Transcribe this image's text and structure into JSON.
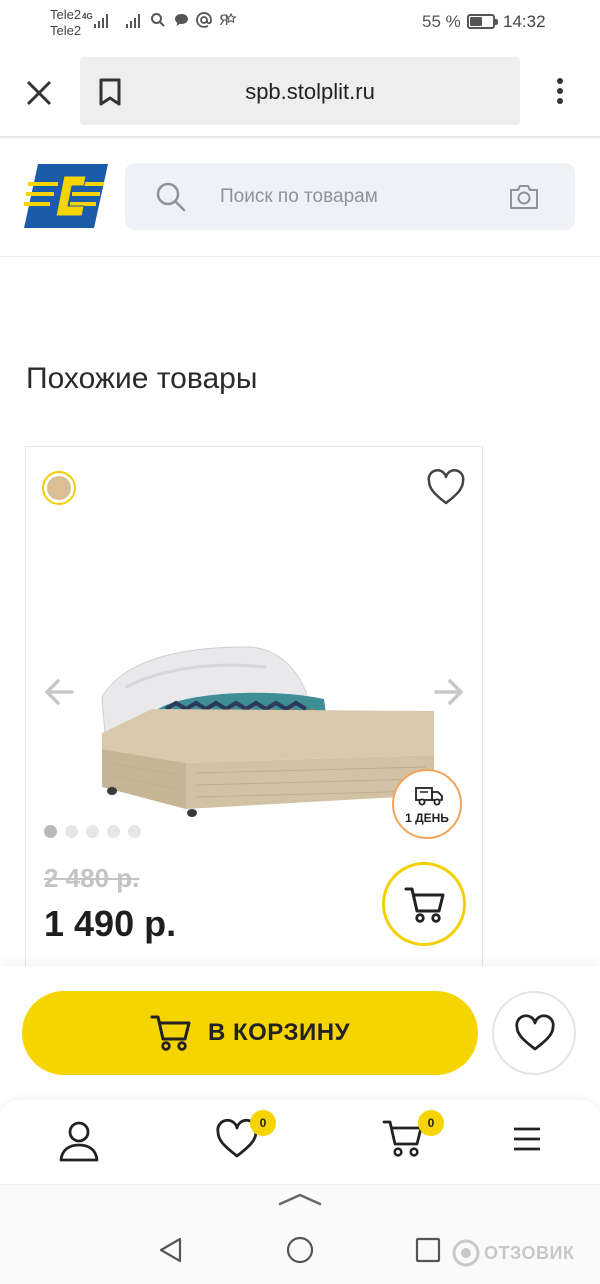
{
  "status_bar": {
    "carrier_1": "Tele2",
    "carrier_2": "Tele2",
    "network": "4G",
    "battery_percent": "55 %",
    "battery_level": 0.55,
    "time": "14:32",
    "icons": [
      "signal-icon",
      "signal-icon",
      "search-icon",
      "chat-icon",
      "at-icon",
      "yandex-icon"
    ]
  },
  "browser": {
    "url": "spb.stolplit.ru",
    "icons": [
      "close-icon",
      "bookmark-icon",
      "more-vert-icon"
    ]
  },
  "site_header": {
    "logo": "stolplit-logo",
    "search_placeholder": "Поиск по товарам",
    "icons": [
      "search-icon",
      "camera-icon"
    ]
  },
  "section": {
    "title": "Похожие товары"
  },
  "product": {
    "swatch_color": "#d9bf93",
    "image": "pull-out-bed-drawer",
    "delivery_badge": "1 ДЕНЬ",
    "gallery_total": 5,
    "gallery_active": 1,
    "old_price": "2 480 р.",
    "price": "1 490 р.",
    "icons": [
      "heart-icon",
      "arrow-left-icon",
      "arrow-right-icon",
      "truck-icon",
      "cart-icon"
    ]
  },
  "action_bar": {
    "add_to_cart_label": "В КОРЗИНУ",
    "accent_color": "#f6d400"
  },
  "bottom_nav": {
    "favorites_count": "0",
    "cart_count": "0",
    "icons": [
      "user-icon",
      "heart-icon",
      "cart-icon",
      "menu-icon"
    ]
  },
  "android_nav": {
    "icons": [
      "chevron-up-icon",
      "back-icon",
      "home-icon",
      "recents-icon"
    ],
    "watermark": "ОТЗОВИК"
  }
}
